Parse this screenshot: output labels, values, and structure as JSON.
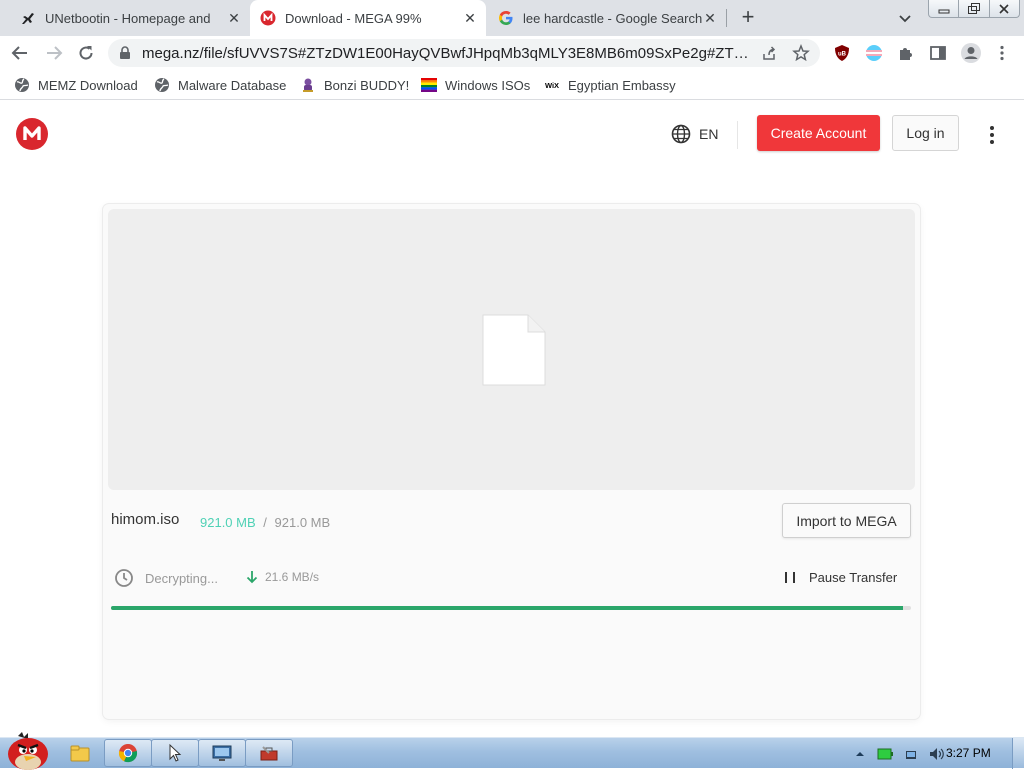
{
  "browser": {
    "tabs": [
      {
        "title": "UNetbootin - Homepage and",
        "favicon": "plane-icon",
        "active": false
      },
      {
        "title": "Download - MEGA 99%",
        "favicon": "mega-icon",
        "active": true
      },
      {
        "title": "lee hardcastle - Google Search",
        "favicon": "google-icon",
        "active": false
      }
    ],
    "url": "mega.nz/file/sfUVVS7S#ZTzDW1E00HayQVBwfJHpqMb3qMLY3E8MB6m09SxPe2g#ZTzD...",
    "bookmarks": [
      {
        "label": "MEMZ Download",
        "icon": "globe-icon"
      },
      {
        "label": "Malware Database",
        "icon": "globe-icon"
      },
      {
        "label": "Bonzi BUDDY!",
        "icon": "bonzi-icon"
      },
      {
        "label": "Windows ISOs",
        "icon": "rainbow-flag-icon"
      },
      {
        "label": "Egyptian Embassy",
        "icon": "wix-icon"
      }
    ]
  },
  "mega": {
    "language": "EN",
    "create_account": "Create Account",
    "login": "Log in",
    "file_name": "himom.iso",
    "downloaded": "921.0 MB",
    "size_sep": "/",
    "total": "921.0 MB",
    "import_label": "Import to MEGA",
    "status": "Decrypting...",
    "speed": "21.6 MB/s",
    "pause_label": "Pause Transfer",
    "progress": 0.99,
    "colors": {
      "brand": "#d9272e",
      "create_button": "#f0373a",
      "progress": "#2ba66a",
      "downloaded": "#4fd1b5"
    }
  },
  "taskbar": {
    "clock": "3:27 PM",
    "items": [
      "explorer-icon",
      "chrome-icon",
      "cursor-app-icon",
      "screen-icon",
      "toolbox-icon"
    ]
  }
}
